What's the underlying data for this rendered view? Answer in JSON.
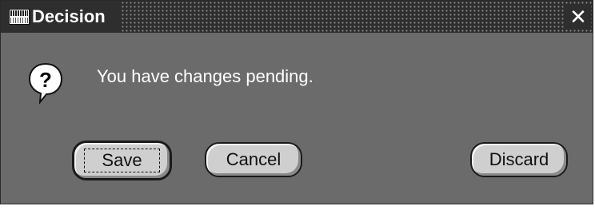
{
  "window": {
    "title": "Decision",
    "close_symbol": "✕",
    "app_icon": "oracle-applications-icon"
  },
  "dialog": {
    "icon": "question-icon",
    "message": "You have changes pending."
  },
  "buttons": {
    "save_label": "Save",
    "cancel_label": "Cancel",
    "discard_label": "Discard"
  },
  "colors": {
    "titlebar": "#2e2e2e",
    "body": "#6b6b6b",
    "button_face": "#cfcfcf",
    "text_light": "#ffffff"
  }
}
